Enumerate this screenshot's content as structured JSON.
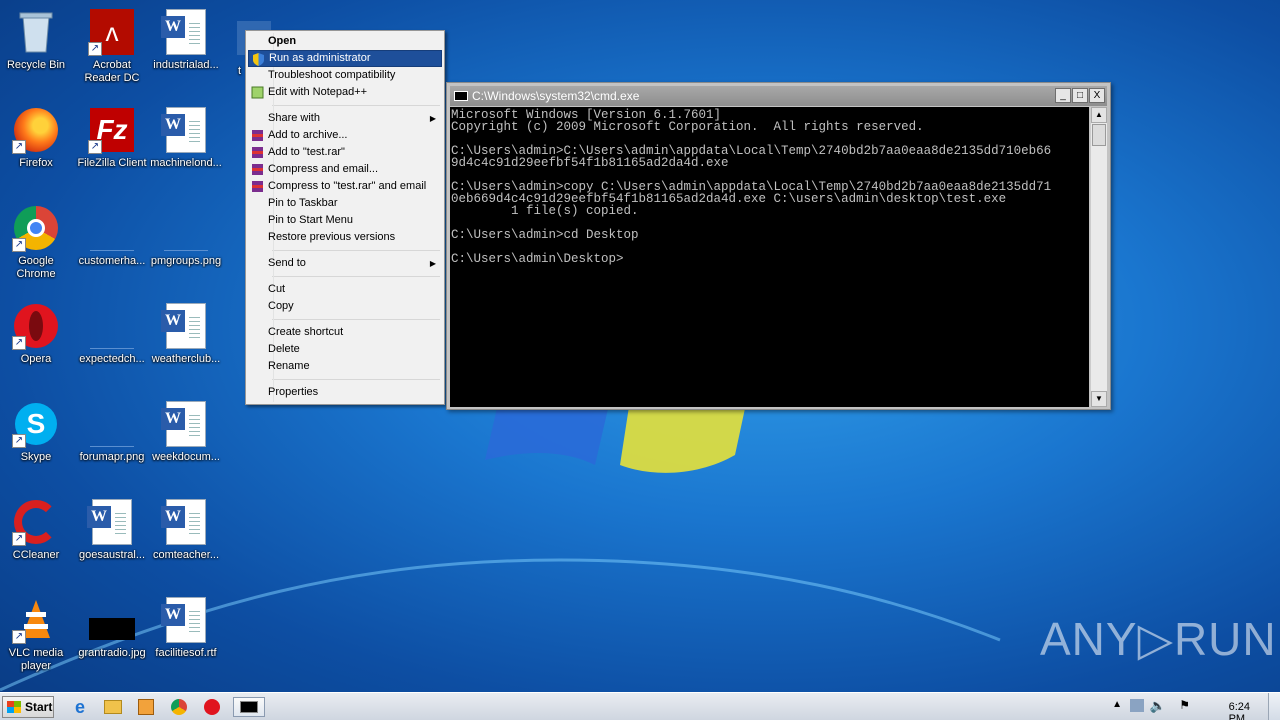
{
  "desktop_icons": [
    {
      "label": "Recycle Bin",
      "icon": "recycle-bin-icon"
    },
    {
      "label": "Acrobat Reader DC",
      "icon": "acrobat-icon"
    },
    {
      "label": "industrialad...",
      "icon": "word-doc-icon"
    },
    {
      "label": "Firefox",
      "icon": "firefox-icon"
    },
    {
      "label": "FileZilla Client",
      "icon": "filezilla-icon"
    },
    {
      "label": "machinelond...",
      "icon": "word-doc-icon"
    },
    {
      "label": "Google Chrome",
      "icon": "chrome-icon"
    },
    {
      "label": "customerha...",
      "icon": "image-file-icon"
    },
    {
      "label": "pmgroups.png",
      "icon": "image-file-icon"
    },
    {
      "label": "Opera",
      "icon": "opera-icon"
    },
    {
      "label": "expectedch...",
      "icon": "image-file-icon"
    },
    {
      "label": "weatherclub...",
      "icon": "word-doc-icon"
    },
    {
      "label": "Skype",
      "icon": "skype-icon"
    },
    {
      "label": "forumapr.png",
      "icon": "image-file-icon"
    },
    {
      "label": "weekdocum...",
      "icon": "word-doc-icon"
    },
    {
      "label": "CCleaner",
      "icon": "ccleaner-icon"
    },
    {
      "label": "goesaustral...",
      "icon": "word-doc-icon"
    },
    {
      "label": "comteacher...",
      "icon": "word-doc-icon"
    },
    {
      "label": "VLC media player",
      "icon": "vlc-icon"
    },
    {
      "label": "grantradio.jpg",
      "icon": "image-file-icon"
    },
    {
      "label": "facilitiesof.rtf",
      "icon": "word-doc-icon"
    }
  ],
  "partial_icon_label": "t",
  "context_menu": {
    "open": "Open",
    "run_as_admin": "Run as administrator",
    "troubleshoot": "Troubleshoot compatibility",
    "edit_notepad": "Edit with Notepad++",
    "share_with": "Share with",
    "add_archive": "Add to archive...",
    "add_test_rar": "Add to \"test.rar\"",
    "compress_email": "Compress and email...",
    "compress_test_email": "Compress to \"test.rar\" and email",
    "pin_taskbar": "Pin to Taskbar",
    "pin_start": "Pin to Start Menu",
    "restore_versions": "Restore previous versions",
    "send_to": "Send to",
    "cut": "Cut",
    "copy": "Copy",
    "create_shortcut": "Create shortcut",
    "delete": "Delete",
    "rename": "Rename",
    "properties": "Properties"
  },
  "cmd": {
    "title": "C:\\Windows\\system32\\cmd.exe",
    "minimize": "_",
    "maximize": "□",
    "close": "X",
    "console_text": "Microsoft Windows [Version 6.1.7601]\nCopyright (c) 2009 Microsoft Corporation.  All rights reserved.\n\nC:\\Users\\admin>C:\\Users\\admin\\appdata\\Local\\Temp\\2740bd2b7aa0eaa8de2135dd710eb66\n9d4c4c91d29eefbf54f1b81165ad2da4d.exe\n\nC:\\Users\\admin>copy C:\\Users\\admin\\appdata\\Local\\Temp\\2740bd2b7aa0eaa8de2135dd71\n0eb669d4c4c91d29eefbf54f1b81165ad2da4d.exe C:\\users\\admin\\desktop\\test.exe\n        1 file(s) copied.\n\nC:\\Users\\admin>cd Desktop\n\nC:\\Users\\admin\\Desktop>"
  },
  "taskbar": {
    "start_label": "Start",
    "clock": "6:24 PM"
  },
  "watermark": "ANY▷RUN"
}
